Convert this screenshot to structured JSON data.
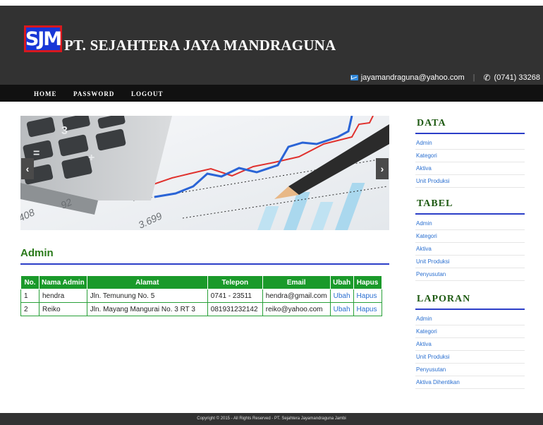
{
  "header": {
    "logo_text": "SJM",
    "company_name": "PT. SEJAHTERA JAYA MANDRAGUNA",
    "email": "jayamandraguna@yahoo.com",
    "separator": "|",
    "phone": "(0741) 33268",
    "email_icon": "mail-icon",
    "phone_icon": "phone-icon"
  },
  "nav": {
    "items": [
      {
        "label": "HOME"
      },
      {
        "label": "PASSWORD"
      },
      {
        "label": "LOGOUT"
      }
    ]
  },
  "slider": {
    "prev_label": "‹",
    "next_label": "›"
  },
  "main": {
    "title": "Admin",
    "table": {
      "headers": [
        "No.",
        "Nama Admin",
        "Alamat",
        "Telepon",
        "Email",
        "Ubah",
        "Hapus"
      ],
      "rows": [
        {
          "no": "1",
          "nama": "hendra",
          "alamat": "Jln. Temunung No. 5",
          "telepon": "0741 - 23511",
          "email": "hendra@gmail.com",
          "ubah": "Ubah",
          "hapus": "Hapus"
        },
        {
          "no": "2",
          "nama": "Reiko",
          "alamat": "Jln. Mayang Mangurai No. 3 RT 3",
          "telepon": "081931232142",
          "email": "reiko@yahoo.com",
          "ubah": "Ubah",
          "hapus": "Hapus"
        }
      ]
    }
  },
  "sidebar": {
    "data": {
      "title": "DATA",
      "items": [
        "Admin",
        "Kategori",
        "Aktiva",
        "Unit Produksi"
      ]
    },
    "tabel": {
      "title": "TABEL",
      "items": [
        "Admin",
        "Kategori",
        "Aktiva",
        "Unit Produksi",
        "Penyusutan"
      ]
    },
    "laporan": {
      "title": "LAPORAN",
      "items": [
        "Admin",
        "Kategori",
        "Aktiva",
        "Unit Produksi",
        "Penyusutan",
        "Aktiva Dihentikan"
      ]
    }
  },
  "footer": {
    "text": "Copyright © 2015 - All Rights Reserved - PT. Sejahtera Jayamandraguna Jambi"
  },
  "colors": {
    "header_bg": "#323232",
    "nav_bg": "#111111",
    "table_header": "#1a9a2a",
    "title_green": "#2a7a1a",
    "rule_blue": "#2c3fc8",
    "link_blue": "#2a6fd0"
  }
}
